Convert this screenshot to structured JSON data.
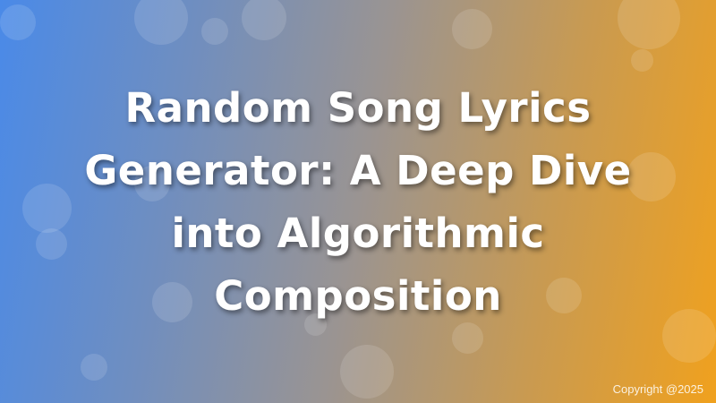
{
  "title": "Random Song Lyrics Generator: A Deep Dive into Algorithmic Composition",
  "copyright": "Copyright @2025",
  "colors": {
    "gradient_start": "#4a8ae8",
    "gradient_end": "#f0a11e",
    "title_text": "#ffffff"
  }
}
